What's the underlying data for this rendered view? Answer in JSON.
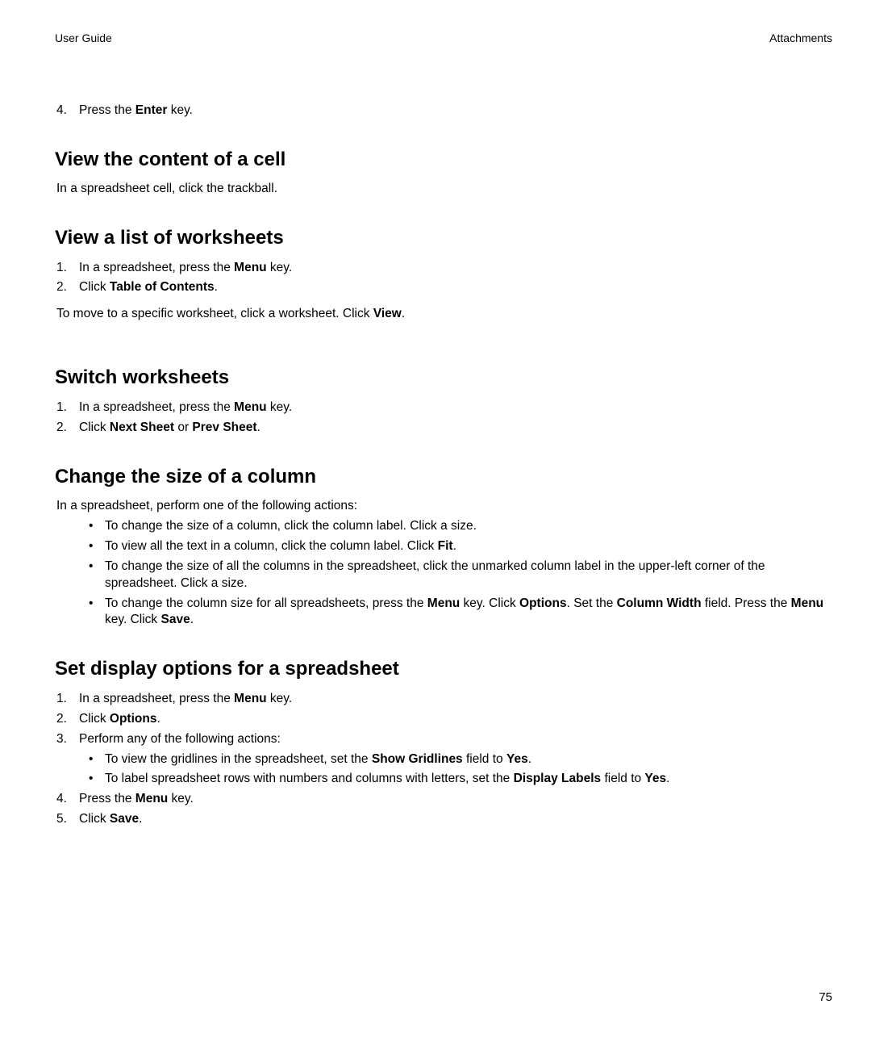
{
  "header": {
    "left": "User Guide",
    "right": "Attachments"
  },
  "pre": {
    "num": "4.",
    "t1": "Press the ",
    "b1": "Enter",
    "t2": " key."
  },
  "s1": {
    "title": "View the content of a cell",
    "p": "In a spreadsheet cell, click the trackball."
  },
  "s2": {
    "title": "View a list of worksheets",
    "i1": {
      "num": "1.",
      "t1": "In a spreadsheet, press the ",
      "b1": "Menu",
      "t2": " key."
    },
    "i2": {
      "num": "2.",
      "t1": "Click ",
      "b1": "Table of Contents",
      "t2": "."
    },
    "p": {
      "t1": "To move to a specific worksheet, click a worksheet. Click ",
      "b1": "View",
      "t2": "."
    }
  },
  "s3": {
    "title": "Switch worksheets",
    "i1": {
      "num": "1.",
      "t1": "In a spreadsheet, press the ",
      "b1": "Menu",
      "t2": " key."
    },
    "i2": {
      "num": "2.",
      "t1": "Click ",
      "b1": "Next Sheet",
      "t2": " or ",
      "b2": "Prev Sheet",
      "t3": "."
    }
  },
  "s4": {
    "title": "Change the size of a column",
    "lead": "In a spreadsheet, perform one of the following actions:",
    "b1": "To change the size of a column, click the column label. Click a size.",
    "b2": {
      "t1": "To view all the text in a column, click the column label. Click ",
      "b1": "Fit",
      "t2": "."
    },
    "b3": "To change the size of all the columns in the spreadsheet, click the unmarked column label in the upper-left corner of the spreadsheet. Click a size.",
    "b4": {
      "t1": "To change the column size for all spreadsheets, press the ",
      "b1": "Menu",
      "t2": " key. Click ",
      "b2": "Options",
      "t3": ". Set the ",
      "b3": "Column Width",
      "t4": " field. Press the ",
      "b4": "Menu",
      "t5": " key. Click ",
      "b5": "Save",
      "t6": "."
    }
  },
  "s5": {
    "title": "Set display options for a spreadsheet",
    "i1": {
      "num": "1.",
      "t1": "In a spreadsheet, press the ",
      "b1": "Menu",
      "t2": " key."
    },
    "i2": {
      "num": "2.",
      "t1": "Click ",
      "b1": "Options",
      "t2": "."
    },
    "i3": {
      "num": "3.",
      "t1": "Perform any of the following actions:"
    },
    "sb1": {
      "t1": "To view the gridlines in the spreadsheet, set the ",
      "b1": "Show Gridlines",
      "t2": " field to ",
      "b2": "Yes",
      "t3": "."
    },
    "sb2": {
      "t1": "To label spreadsheet rows with numbers and columns with letters, set the ",
      "b1": "Display Labels",
      "t2": " field to ",
      "b2": "Yes",
      "t3": "."
    },
    "i4": {
      "num": "4.",
      "t1": "Press the ",
      "b1": "Menu",
      "t2": " key."
    },
    "i5": {
      "num": "5.",
      "t1": "Click ",
      "b1": "Save",
      "t2": "."
    }
  },
  "page_number": "75"
}
